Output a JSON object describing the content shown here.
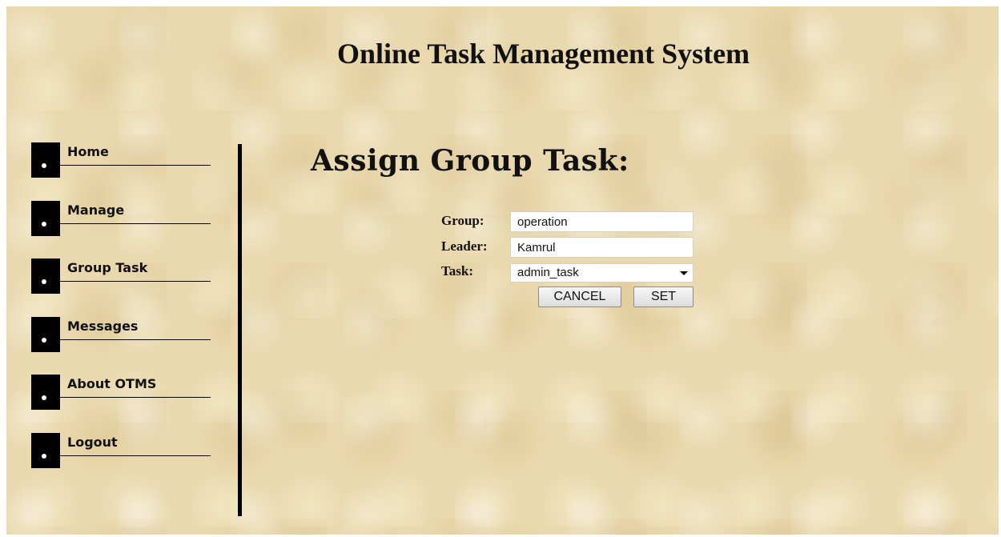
{
  "header": {
    "title": "Online Task Management System"
  },
  "sidebar": {
    "items": [
      {
        "label": "Home"
      },
      {
        "label": "Manage"
      },
      {
        "label": "Group Task"
      },
      {
        "label": "Messages"
      },
      {
        "label": "About OTMS"
      },
      {
        "label": "Logout"
      }
    ]
  },
  "main": {
    "heading": "Assign Group Task:",
    "form": {
      "group_label": "Group:",
      "group_value": "operation",
      "leader_label": "Leader:",
      "leader_value": "Kamrul",
      "task_label": "Task:",
      "task_selected": "admin_task",
      "cancel_label": "CANCEL",
      "set_label": "SET"
    }
  },
  "colors": {
    "background": "#ead9ae",
    "text": "#111111",
    "nav_block": "#000000"
  }
}
